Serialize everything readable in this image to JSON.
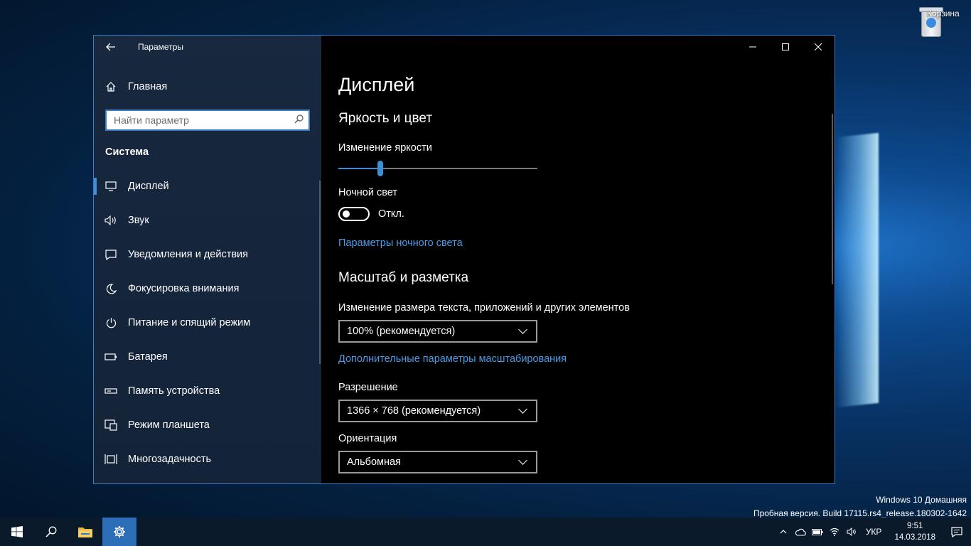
{
  "window": {
    "title": "Параметры"
  },
  "sidebar": {
    "home_label": "Главная",
    "search": {
      "placeholder": "Найти параметр"
    },
    "section": "Система",
    "items": [
      {
        "label": "Дисплей",
        "icon": "monitor-icon",
        "active": true
      },
      {
        "label": "Звук",
        "icon": "speaker-icon"
      },
      {
        "label": "Уведомления и действия",
        "icon": "message-icon"
      },
      {
        "label": "Фокусировка внимания",
        "icon": "moon-icon"
      },
      {
        "label": "Питание и спящий режим",
        "icon": "power-icon"
      },
      {
        "label": "Батарея",
        "icon": "battery-icon"
      },
      {
        "label": "Память устройства",
        "icon": "storage-icon"
      },
      {
        "label": "Режим планшета",
        "icon": "tablet-icon"
      },
      {
        "label": "Многозадачность",
        "icon": "multitask-icon"
      }
    ]
  },
  "main": {
    "title": "Дисплей",
    "brightness_section": {
      "heading": "Яркость и цвет",
      "brightness_label": "Изменение яркости",
      "brightness_value_fraction": 0.21,
      "night_light_label": "Ночной свет",
      "night_light_state": "Откл.",
      "night_light_on": false,
      "night_light_link": "Параметры ночного света"
    },
    "scale_section": {
      "heading": "Масштаб и разметка",
      "size_label": "Изменение размера текста, приложений и других элементов",
      "size_value": "100% (рекомендуется)",
      "advanced_link": "Дополнительные параметры масштабирования",
      "resolution_label": "Разрешение",
      "resolution_value": "1366 × 768 (рекомендуется)",
      "orientation_label": "Ориентация",
      "orientation_value": "Альбомная"
    }
  },
  "desktop": {
    "recycle_bin_label": "Корзина",
    "watermark_line1": "Windows 10 Домашняя",
    "watermark_line2": "Пробная версия. Build 17115.rs4_release.180302-1642"
  },
  "taskbar": {
    "lang": "УКР",
    "time": "9:51",
    "date": "14.03.2018"
  },
  "colors": {
    "accent": "#3a8fd6",
    "link": "#4a9be8",
    "sidebar_bg": "#17283f",
    "content_bg": "#000000",
    "taskbar_active": "#2c6fb8"
  }
}
